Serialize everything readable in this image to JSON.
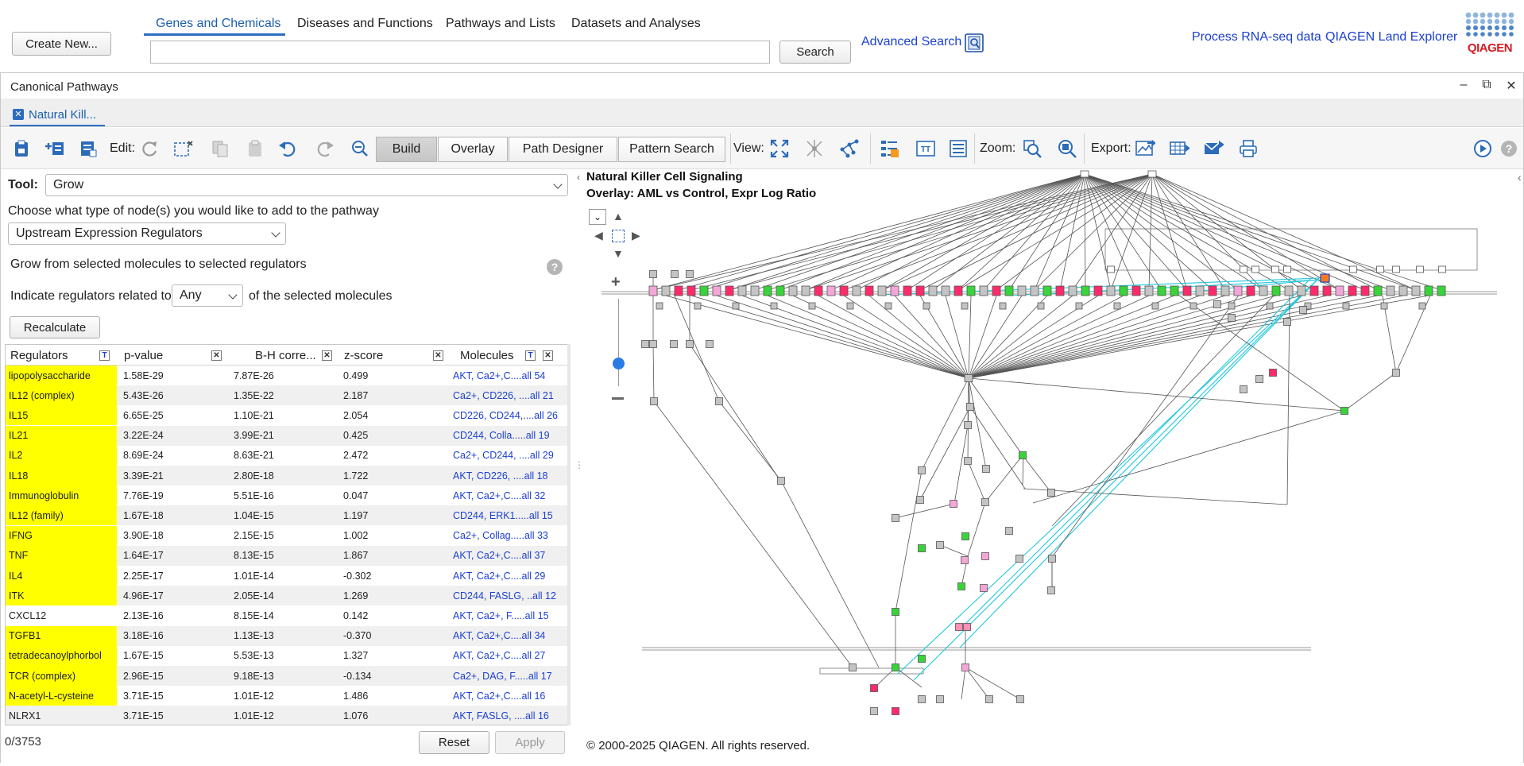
{
  "header": {
    "create_label": "Create New...",
    "nav_tabs": [
      {
        "label": "Genes and Chemicals",
        "active": true
      },
      {
        "label": "Diseases and Functions"
      },
      {
        "label": "Pathways and Lists"
      },
      {
        "label": "Datasets and Analyses"
      }
    ],
    "search_value": "",
    "search_label": "Search",
    "advanced_search_label": "Advanced Search",
    "process_rnaseq_label": "Process RNA-seq data",
    "land_explorer_label": "QIAGEN Land Explorer",
    "logo_text": "QIAGEN"
  },
  "panel": {
    "title": "Canonical Pathways",
    "tab_label": "Natural Kill..."
  },
  "toolbar": {
    "edit_label": "Edit:",
    "modes": [
      "Build",
      "Overlay",
      "Path Designer",
      "Pattern Search"
    ],
    "active_mode": "Build",
    "view_label": "View:",
    "zoom_label": "Zoom:",
    "export_label": "Export:"
  },
  "tool_panel": {
    "tool_label": "Tool:",
    "tool_value": "Grow",
    "choose_label": "Choose what type of node(s) you would like to add to the pathway",
    "node_type_value": "Upstream Expression Regulators",
    "grow_from_label": "Grow from selected molecules to selected regulators",
    "indicate_prefix": "Indicate regulators related to",
    "indicate_value": "Any",
    "indicate_suffix": "of the selected molecules",
    "recalculate_label": "Recalculate",
    "count_label": "0/3753",
    "reset_label": "Reset",
    "apply_label": "Apply"
  },
  "regulators_table": {
    "columns": [
      "Regulators",
      "p-value",
      "B-H corre...",
      "z-score",
      "Molecules"
    ],
    "rows": [
      {
        "regulator": "lipopolysaccharide",
        "highlight": true,
        "p_value": "1.58E-29",
        "bh": "7.87E-26",
        "z": "0.499",
        "molecules": "AKT, Ca2+,C....all 54"
      },
      {
        "regulator": "IL12 (complex)",
        "highlight": true,
        "p_value": "5.43E-26",
        "bh": "1.35E-22",
        "z": "2.187",
        "molecules": "Ca2+, CD226, ....all 21"
      },
      {
        "regulator": "IL15",
        "highlight": true,
        "p_value": "6.65E-25",
        "bh": "1.10E-21",
        "z": "2.054",
        "molecules": "CD226, CD244,....all 26"
      },
      {
        "regulator": "IL21",
        "highlight": true,
        "p_value": "3.22E-24",
        "bh": "3.99E-21",
        "z": "0.425",
        "molecules": "CD244, Colla.....all 19"
      },
      {
        "regulator": "IL2",
        "highlight": true,
        "p_value": "8.69E-24",
        "bh": "8.63E-21",
        "z": "2.472",
        "molecules": "Ca2+, CD244, ....all 29"
      },
      {
        "regulator": "IL18",
        "highlight": true,
        "p_value": "3.39E-21",
        "bh": "2.80E-18",
        "z": "1.722",
        "molecules": "AKT, CD226, ....all 18"
      },
      {
        "regulator": "Immunoglobulin",
        "highlight": true,
        "p_value": "7.76E-19",
        "bh": "5.51E-16",
        "z": "0.047",
        "molecules": "AKT, Ca2+,C....all 32"
      },
      {
        "regulator": "IL12 (family)",
        "highlight": true,
        "p_value": "1.67E-18",
        "bh": "1.04E-15",
        "z": "1.197",
        "molecules": "CD244, ERK1.....all 15"
      },
      {
        "regulator": "IFNG",
        "highlight": true,
        "p_value": "3.90E-18",
        "bh": "2.15E-15",
        "z": "1.002",
        "molecules": "Ca2+, Collag.....all 33"
      },
      {
        "regulator": "TNF",
        "highlight": true,
        "p_value": "1.64E-17",
        "bh": "8.13E-15",
        "z": "1.867",
        "molecules": "AKT, Ca2+,C....all 37"
      },
      {
        "regulator": "IL4",
        "highlight": true,
        "p_value": "2.25E-17",
        "bh": "1.01E-14",
        "z": "-0.302",
        "molecules": "AKT, Ca2+,C....all 29"
      },
      {
        "regulator": "ITK",
        "highlight": true,
        "p_value": "4.96E-17",
        "bh": "2.05E-14",
        "z": "1.269",
        "molecules": "CD244, FASLG, ..all 12"
      },
      {
        "regulator": "CXCL12",
        "highlight": false,
        "p_value": "2.13E-16",
        "bh": "8.15E-14",
        "z": "0.142",
        "molecules": "AKT, Ca2+, F.....all 15"
      },
      {
        "regulator": "TGFB1",
        "highlight": true,
        "p_value": "3.18E-16",
        "bh": "1.13E-13",
        "z": "-0.370",
        "molecules": "AKT, Ca2+,C....all 34"
      },
      {
        "regulator": "tetradecanoylphorbol",
        "highlight": true,
        "p_value": "1.67E-15",
        "bh": "5.53E-13",
        "z": "1.327",
        "molecules": "AKT, Ca2+,C....all 27"
      },
      {
        "regulator": "TCR (complex)",
        "highlight": true,
        "p_value": "2.96E-15",
        "bh": "9.18E-13",
        "z": "-0.134",
        "molecules": "Ca2+, DAG, F.....all 17"
      },
      {
        "regulator": "N-acetyl-L-cysteine",
        "highlight": true,
        "p_value": "3.71E-15",
        "bh": "1.01E-12",
        "z": "1.486",
        "molecules": "AKT, Ca2+,C....all 16"
      },
      {
        "regulator": "NLRX1",
        "highlight": false,
        "p_value": "3.71E-15",
        "bh": "1.01E-12",
        "z": "1.076",
        "molecules": "AKT, FASLG, ....all 16"
      }
    ]
  },
  "pathway": {
    "title": "Natural Killer Cell Signaling",
    "overlay": "Overlay: AML vs Control, Expr Log Ratio",
    "copyright": "© 2000-2025 QIAGEN. All rights reserved.",
    "colors": {
      "up": "#ff2a6a",
      "down": "#39d439",
      "none": "#c4c4c4",
      "edge": "#555555",
      "highlight_edge": "#22c8dc"
    }
  }
}
